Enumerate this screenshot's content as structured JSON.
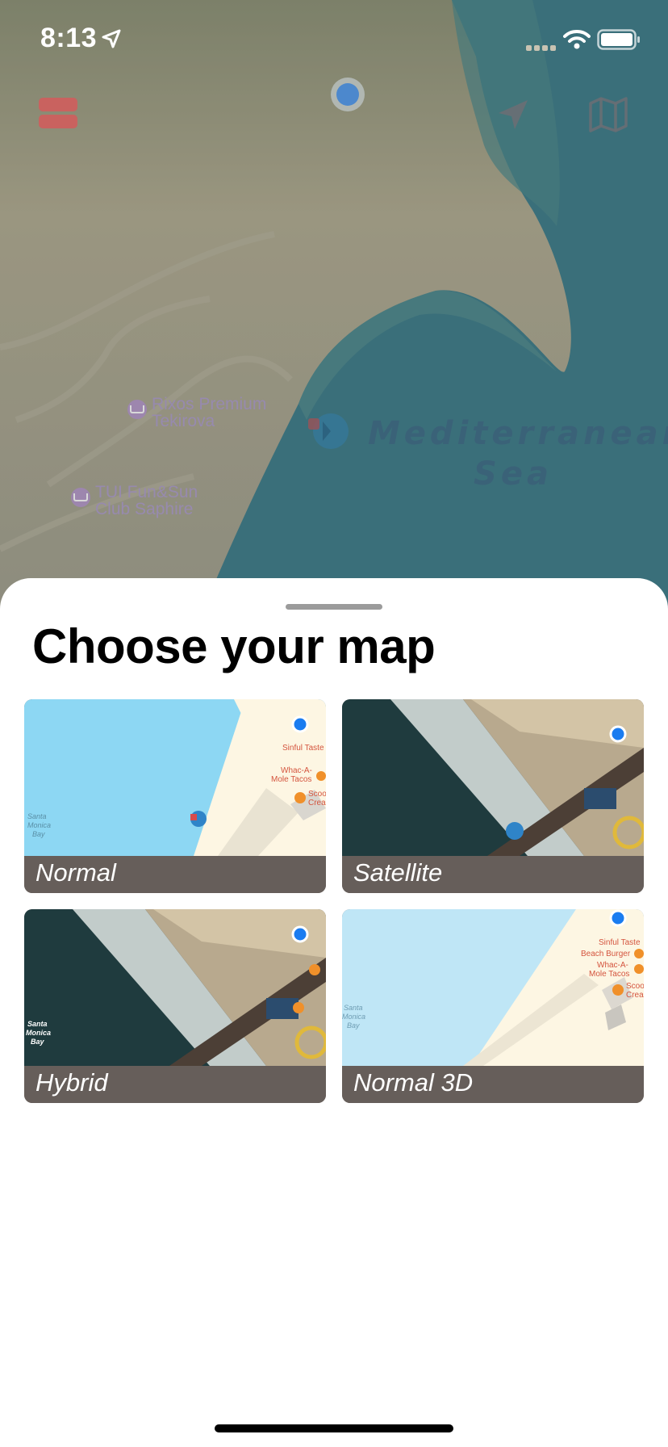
{
  "status_bar": {
    "time": "8:13"
  },
  "icons": {
    "location_arrow": "location-arrow-icon",
    "wifi": "wifi-icon",
    "battery": "battery-icon",
    "layers": "layers-icon",
    "locate": "navigation-arrow-icon",
    "map_type": "map-icon"
  },
  "map": {
    "pois": [
      {
        "name": "Rixos Premium\nTekirova"
      },
      {
        "name": "TUI Fun&Sun\nClub Saphire"
      }
    ],
    "sea_label": "Mediterranean\nSea"
  },
  "sheet": {
    "title": "Choose your map",
    "options": [
      {
        "label": "Normal",
        "thumb_labels": [
          "Sinful Taste",
          "Whac-A-",
          "Mole Tacos",
          "Scoo",
          "Crea",
          "Santa",
          "Monica",
          "Bay"
        ]
      },
      {
        "label": "Satellite",
        "thumb_labels": []
      },
      {
        "label": "Hybrid",
        "thumb_labels": [
          "Santa",
          "Monica",
          "Bay"
        ]
      },
      {
        "label": "Normal 3D",
        "thumb_labels": [
          "Sinful Taste",
          "Beach Burger",
          "Whac-A-",
          "Mole Tacos",
          "Scoo",
          "Crea",
          "Santa",
          "Monica",
          "Bay"
        ]
      }
    ]
  },
  "colors": {
    "land": "#a9a897",
    "sea": "#3f7f8d",
    "accent_blue": "#1a7cf0",
    "card_bar": "#665e5a",
    "layers_button": "#c9625f"
  }
}
